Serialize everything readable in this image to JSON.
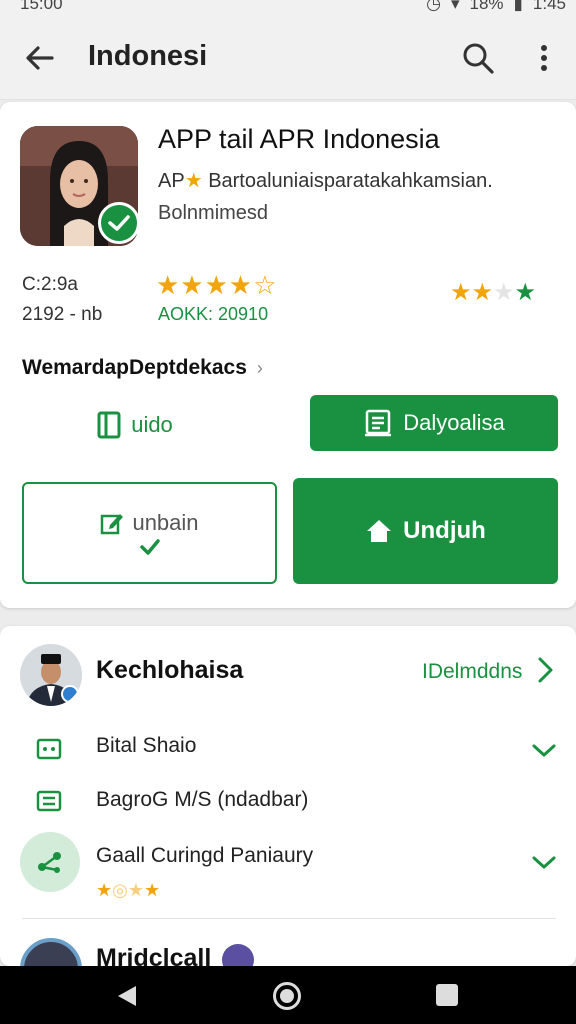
{
  "status_bar": {
    "time_left": "15:00",
    "battery": "18%",
    "clock": "1:45"
  },
  "app_bar": {
    "title": "Indonesi"
  },
  "app": {
    "name": "APP tail APR Indonesia",
    "subtitle_prefix": "AP",
    "subtitle_rest": "Bartoaluniaisparatakahkamsian.",
    "developer": "Bolnmimesd"
  },
  "stats": {
    "line1": "C:2:9a",
    "line2": "2192 - nb",
    "rating_stars": "★★★★☆",
    "rating_code": "AOKK: 20910",
    "mini_rating_filled": "★★",
    "mini_rating_empty": "★",
    "mini_rating_badge": "★"
  },
  "section": {
    "link_label": "WemardapDeptdekacs",
    "chevron": "›"
  },
  "buttons": {
    "text_button": "uido",
    "green_button_1": "Dalyoalisa",
    "outline_button": "unbain",
    "green_button_2": "Undjuh"
  },
  "developer_card": {
    "name": "Kechlohaisa",
    "link": "IDelmddns",
    "rows": [
      {
        "label": "Bital Shaio"
      },
      {
        "label": "BagroG M/S (ndadbar)"
      },
      {
        "label": "Gaall Curingd Paniaury",
        "stars_filled": "★",
        "stars_mid": "◎★",
        "stars_end": "★"
      }
    ],
    "peek_name": "Mridclcall"
  },
  "colors": {
    "accent": "#1a9140",
    "star": "#f2a40c"
  }
}
